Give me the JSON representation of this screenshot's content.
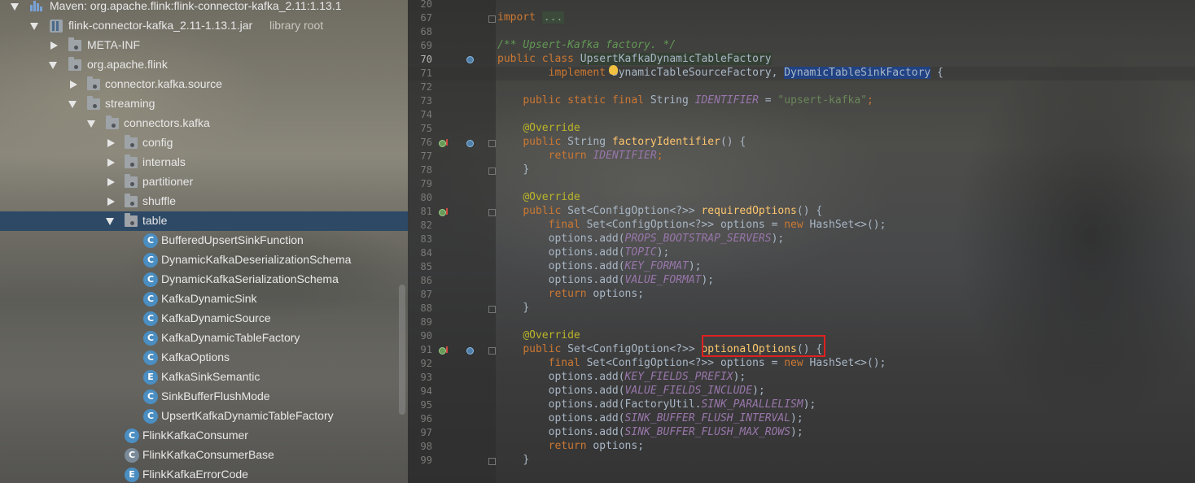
{
  "tree": {
    "maven_root": "Maven: org.apache.flink:flink-connector-kafka_2.11:1.13.1",
    "jar_name": "flink-connector-kafka_2.11-1.13.1.jar",
    "jar_tag": "library root",
    "meta_inf": "META-INF",
    "pkg_root": "org.apache.flink",
    "pkg_connector_source": "connector.kafka.source",
    "pkg_streaming": "streaming",
    "pkg_connectors_kafka": "connectors.kafka",
    "pkg_config": "config",
    "pkg_internals": "internals",
    "pkg_partitioner": "partitioner",
    "pkg_shuffle": "shuffle",
    "pkg_table": "table",
    "classes": [
      {
        "name": "BufferedUpsertSinkFunction",
        "kind": "C"
      },
      {
        "name": "DynamicKafkaDeserializationSchema",
        "kind": "C"
      },
      {
        "name": "DynamicKafkaSerializationSchema",
        "kind": "C"
      },
      {
        "name": "KafkaDynamicSink",
        "kind": "C"
      },
      {
        "name": "KafkaDynamicSource",
        "kind": "C"
      },
      {
        "name": "KafkaDynamicTableFactory",
        "kind": "C"
      },
      {
        "name": "KafkaOptions",
        "kind": "C"
      },
      {
        "name": "KafkaSinkSemantic",
        "kind": "E"
      },
      {
        "name": "SinkBufferFlushMode",
        "kind": "C"
      },
      {
        "name": "UpsertKafkaDynamicTableFactory",
        "kind": "C"
      }
    ],
    "after": [
      {
        "name": "FlinkKafkaConsumer",
        "kind": "C"
      },
      {
        "name": "FlinkKafkaConsumerBase",
        "kind": "C"
      },
      {
        "name": "FlinkKafkaErrorCode",
        "kind": "E"
      }
    ]
  },
  "editor": {
    "line_numbers": [
      "20",
      "67",
      "68",
      "69",
      "70",
      "71",
      "72",
      "73",
      "74",
      "75",
      "76",
      "77",
      "78",
      "79",
      "80",
      "81",
      "82",
      "83",
      "84",
      "85",
      "86",
      "87",
      "88",
      "89",
      "90",
      "91",
      "92",
      "93",
      "94",
      "95",
      "96",
      "97",
      "98",
      "99"
    ],
    "import_kw": "import",
    "import_dots": "...",
    "comment": "/** Upsert-Kafka factory. */",
    "l69_public": "public",
    "l69_class": "class",
    "l69_name": "UpsertKafkaDynamicTableFactory",
    "l70_implements": "implement",
    "l70_iface1": "DynamicTableSourceFactory, ",
    "l70_iface2": "DynamicTableSinkFactory",
    "l70_brace": " {",
    "l72_mods": "public static final",
    "l72_type": " String ",
    "l72_const": "IDENTIFIER",
    "l72_eq": " = ",
    "l72_str": "\"upsert-kafka\"",
    "l72_semi": ";",
    "override": "@Override",
    "l75_public": "public",
    "l75_type": " String ",
    "l75_fn": "factoryIdentifier",
    "l75_rest": "() {",
    "l76_return": "return",
    "l76_const": "IDENTIFIER",
    "l76_semi": ";",
    "close_brace": "}",
    "l80_public": "public",
    "l80_type": " Set<ConfigOption<?>> ",
    "l80_fn": "requiredOptions",
    "l80_rest": "() {",
    "final_kw": "final",
    "new_kw": "new",
    "set_decl": " Set<ConfigOption<?>> options = ",
    "hashset": " HashSet<>();",
    "opt_add": "options.add(",
    "opt_close": ");",
    "req_opts": [
      "PROPS_BOOTSTRAP_SERVERS",
      "TOPIC",
      "KEY_FORMAT",
      "VALUE_FORMAT"
    ],
    "return_kw": "return",
    "return_opts": " options;",
    "l90_public": "public",
    "l90_type": " Set<ConfigOption<?>> ",
    "l90_fn": "optionalOptions",
    "l90_rest": "() {",
    "opt_opts": [
      "KEY_FIELDS_PREFIX",
      "VALUE_FIELDS_INCLUDE"
    ],
    "factory_util": "FactoryUtil.",
    "sink_parallelism": "SINK_PARALLELISM",
    "opt_opts2": [
      "SINK_BUFFER_FLUSH_INTERVAL",
      "SINK_BUFFER_FLUSH_MAX_ROWS"
    ]
  }
}
